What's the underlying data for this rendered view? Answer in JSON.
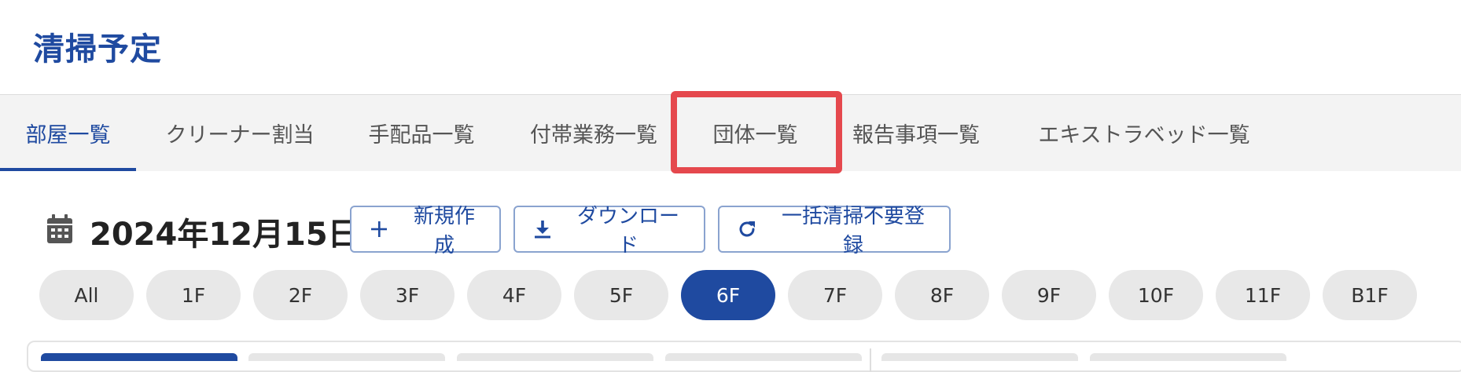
{
  "page": {
    "title": "清掃予定"
  },
  "tabs": [
    {
      "label": "部屋一覧",
      "active": true
    },
    {
      "label": "クリーナー割当",
      "active": false
    },
    {
      "label": "手配品一覧",
      "active": false
    },
    {
      "label": "付帯業務一覧",
      "active": false
    },
    {
      "label": "団体一覧",
      "active": false,
      "highlighted": true
    },
    {
      "label": "報告事項一覧",
      "active": false
    },
    {
      "label": "エキストラベッド一覧",
      "active": false
    }
  ],
  "date": {
    "label": "2024年12月15日",
    "icon": "calendar-icon"
  },
  "actions": {
    "new_label": "新規作成",
    "download_label": "ダウンロード",
    "bulk_label": "一括清掃不要登録"
  },
  "floors": [
    {
      "label": "All",
      "active": false
    },
    {
      "label": "1F",
      "active": false
    },
    {
      "label": "2F",
      "active": false
    },
    {
      "label": "3F",
      "active": false
    },
    {
      "label": "4F",
      "active": false
    },
    {
      "label": "5F",
      "active": false
    },
    {
      "label": "6F",
      "active": true
    },
    {
      "label": "7F",
      "active": false
    },
    {
      "label": "8F",
      "active": false
    },
    {
      "label": "9F",
      "active": false
    },
    {
      "label": "10F",
      "active": false
    },
    {
      "label": "11F",
      "active": false
    },
    {
      "label": "B1F",
      "active": false
    }
  ],
  "colors": {
    "primary": "#1f4aa0",
    "highlight": "#e5484d",
    "tabbar_bg": "#f3f3f3",
    "pill_bg": "#e8e8e8"
  }
}
